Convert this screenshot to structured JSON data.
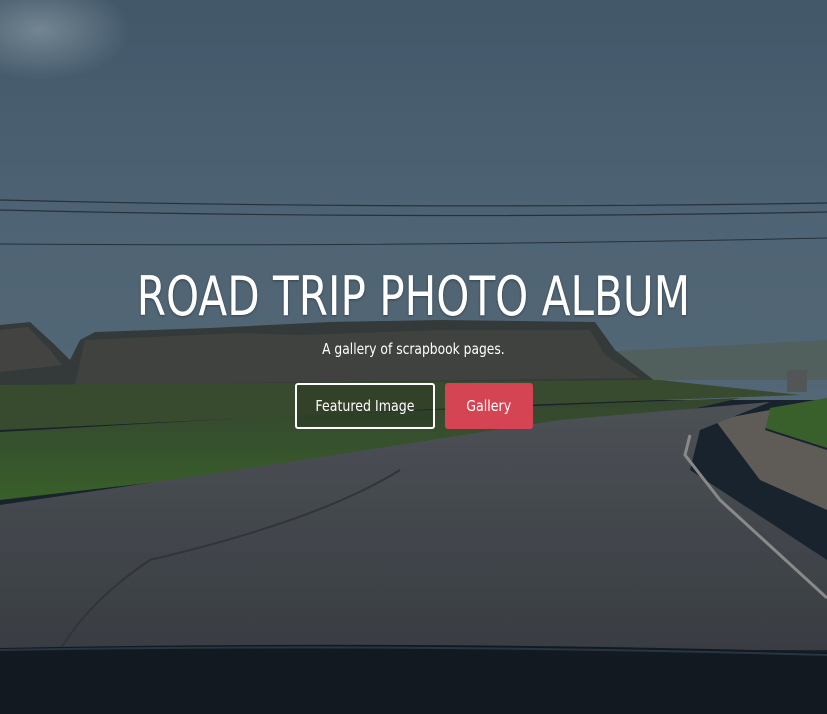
{
  "hero": {
    "title": "ROAD TRIP PHOTO ALBUM",
    "subtitle": "A gallery of scrapbook pages.",
    "buttons": {
      "featured_label": "Featured Image",
      "gallery_label": "Gallery"
    }
  },
  "colors": {
    "accent": "#d44452",
    "text": "#ffffff",
    "sky_overlay": "#4a6275",
    "road": "#4d5157",
    "grass": "#3c5a2c"
  },
  "background": {
    "description_icon": "road-landscape-photo"
  }
}
